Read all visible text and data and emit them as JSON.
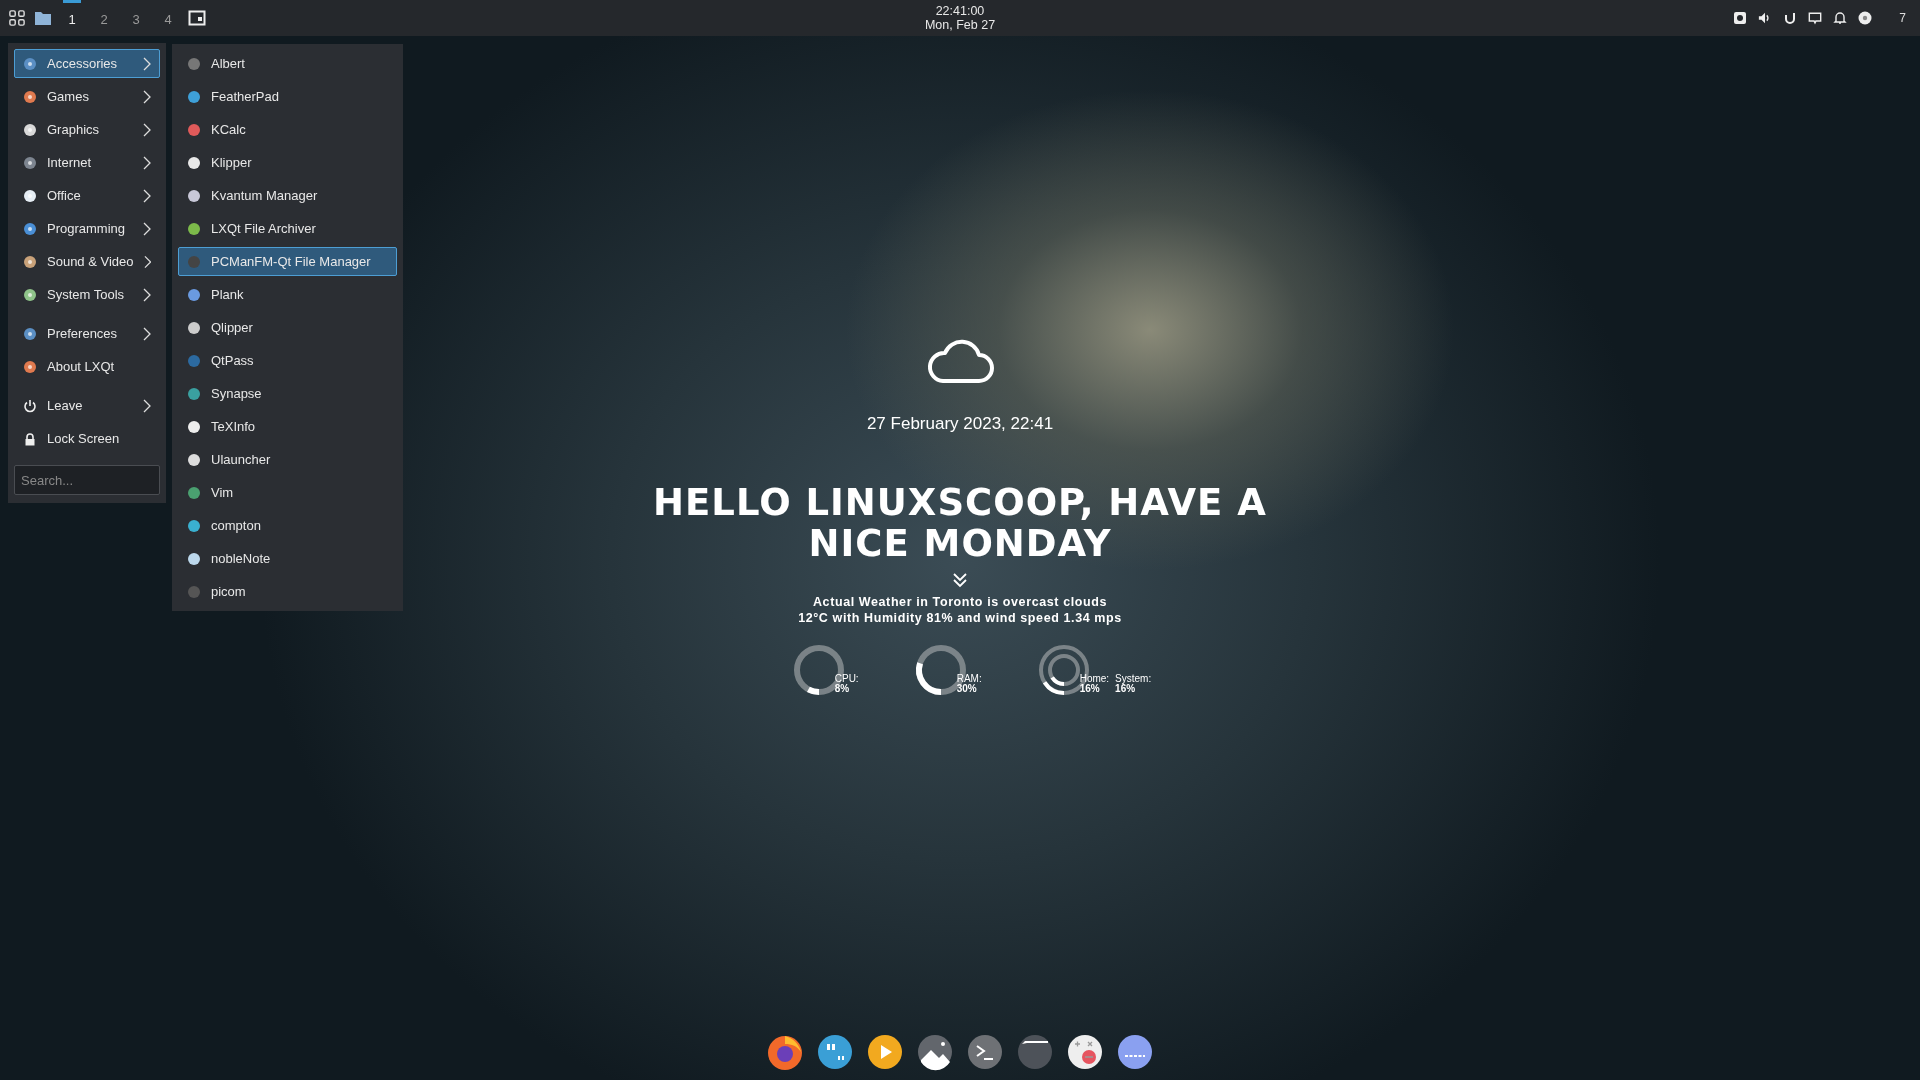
{
  "panel": {
    "workspaces": [
      {
        "label": "1",
        "selected": true
      },
      {
        "label": "2",
        "selected": false
      },
      {
        "label": "3",
        "selected": false
      },
      {
        "label": "4",
        "selected": false
      }
    ],
    "clock": {
      "time": "22:41:00",
      "date": "Mon, Feb 27"
    },
    "tray_count": "7"
  },
  "menu": {
    "groups": [
      [
        {
          "label": "Accessories",
          "submenu": true,
          "selected": true
        },
        {
          "label": "Games",
          "submenu": true,
          "selected": false
        },
        {
          "label": "Graphics",
          "submenu": true,
          "selected": false
        },
        {
          "label": "Internet",
          "submenu": true,
          "selected": false
        },
        {
          "label": "Office",
          "submenu": true,
          "selected": false
        },
        {
          "label": "Programming",
          "submenu": true,
          "selected": false
        },
        {
          "label": "Sound & Video",
          "submenu": true,
          "selected": false
        },
        {
          "label": "System Tools",
          "submenu": true,
          "selected": false
        }
      ],
      [
        {
          "label": "Preferences",
          "submenu": true,
          "selected": false
        },
        {
          "label": "About LXQt",
          "submenu": false,
          "selected": false
        }
      ],
      [
        {
          "label": "Leave",
          "submenu": true,
          "selected": false
        },
        {
          "label": "Lock Screen",
          "submenu": false,
          "selected": false
        }
      ]
    ],
    "search": {
      "placeholder": "Search..."
    }
  },
  "submenu": {
    "items": [
      {
        "label": "Albert",
        "selected": false
      },
      {
        "label": "FeatherPad",
        "selected": false
      },
      {
        "label": "KCalc",
        "selected": false
      },
      {
        "label": "Klipper",
        "selected": false
      },
      {
        "label": "Kvantum Manager",
        "selected": false
      },
      {
        "label": "LXQt File Archiver",
        "selected": false
      },
      {
        "label": "PCManFM-Qt File Manager",
        "selected": true
      },
      {
        "label": "Plank",
        "selected": false
      },
      {
        "label": "Qlipper",
        "selected": false
      },
      {
        "label": "QtPass",
        "selected": false
      },
      {
        "label": "Synapse",
        "selected": false
      },
      {
        "label": "TeXInfo",
        "selected": false
      },
      {
        "label": "Ulauncher",
        "selected": false
      },
      {
        "label": "Vim",
        "selected": false
      },
      {
        "label": "compton",
        "selected": false
      },
      {
        "label": "nobleNote",
        "selected": false
      },
      {
        "label": "picom",
        "selected": false
      }
    ]
  },
  "widget": {
    "date": "27 February 2023, 22:41",
    "greeting": "HELLO LINUXSCOOP, HAVE A NICE MONDAY",
    "weather": [
      "Actual Weather in Toronto is overcast clouds",
      "12°C with Humidity 81% and wind speed 1.34 mps"
    ],
    "gauges": [
      {
        "kind": "single",
        "rings": [
          {
            "label": "CPU:",
            "value": "8%"
          }
        ]
      },
      {
        "kind": "single",
        "rings": [
          {
            "label": "RAM:",
            "value": "30%"
          }
        ]
      },
      {
        "kind": "double",
        "rings": [
          {
            "label": "Home:",
            "value": "16%"
          },
          {
            "label": "System:",
            "value": "16%"
          }
        ]
      }
    ]
  }
}
